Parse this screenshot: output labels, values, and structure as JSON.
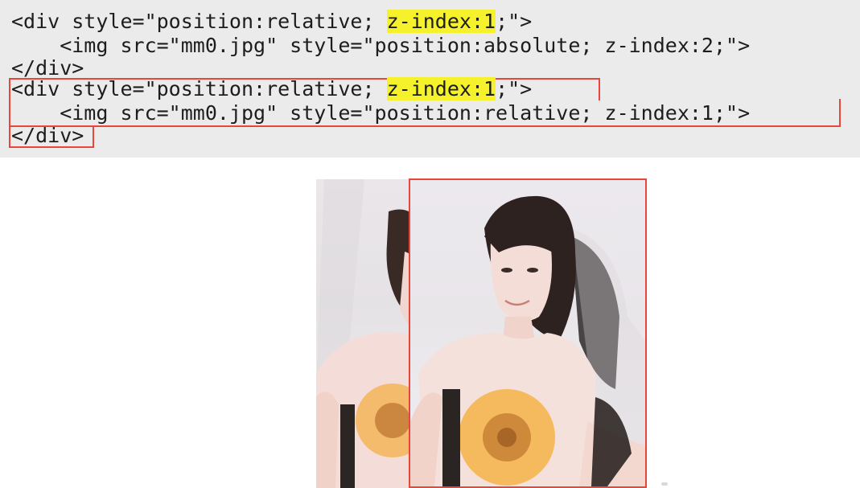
{
  "code": {
    "line1": {
      "pre": "<div style=\"position:relative; ",
      "highlight": "z-index:1",
      "post": ";\">"
    },
    "line2": "    <img src=\"mm0.jpg\" style=\"position:absolute; z-index:2;\">",
    "line3": "</div>",
    "line4": {
      "pre": "<div style=\"position:relative; ",
      "highlight": "z-index:1",
      "post": ";\">"
    },
    "line5": "    <img src=\"mm0.jpg\" style=\"position:relative; z-index:1;\">",
    "line6": "</div>"
  },
  "colors": {
    "code_background": "#ebebeb",
    "highlight": "#f5f22c",
    "outline": "#e8453c"
  },
  "images": {
    "back_photo": "mm0-photo",
    "front_photo": "mm0-photo"
  }
}
